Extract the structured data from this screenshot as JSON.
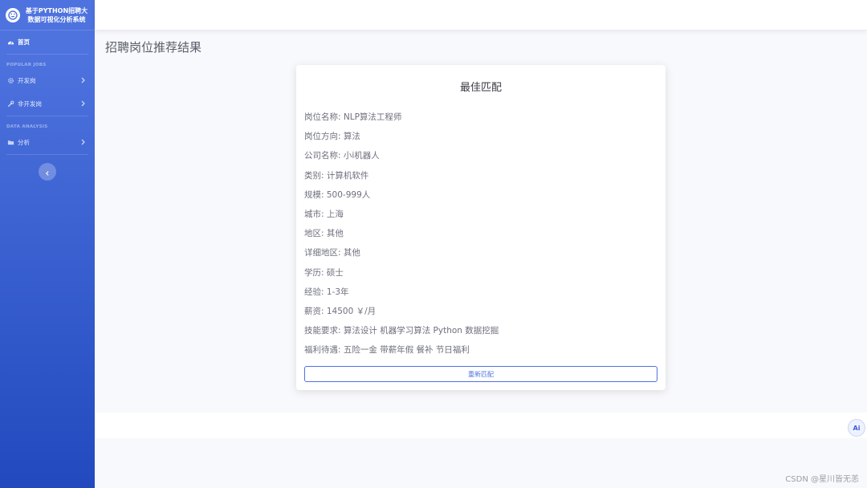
{
  "sidebar": {
    "brand": "基于PYTHON招聘大数据可视化分析系统",
    "home_label": "首页",
    "section1_heading": "POPULAR JOBS",
    "dev_jobs_label": "开发岗",
    "nondev_jobs_label": "非开发岗",
    "section2_heading": "DATA ANALYSIS",
    "analysis_label": "分析"
  },
  "main": {
    "page_title": "招聘岗位推荐结果",
    "card_title": "最佳匹配",
    "fields": [
      "岗位名称: NLP算法工程师",
      "岗位方向: 算法",
      "公司名称: 小i机器人",
      "类别: 计算机软件",
      "规模: 500-999人",
      "城市: 上海",
      "地区: 其他",
      "详细地区: 其他",
      "学历: 硕士",
      "经验: 1-3年",
      "薪资: 14500 ￥/月",
      "技能要求: 算法设计 机器学习算法 Python 数据挖掘",
      "福利待遇: 五险一金 带薪年假 餐补 节日福利"
    ],
    "rematch_label": "重新匹配"
  },
  "ai_button_label": "Ai",
  "watermark": "CSDN @星川皆无恙",
  "colors": {
    "sidebar_start": "#4e73df",
    "sidebar_end": "#224abe",
    "primary": "#4e73df"
  }
}
